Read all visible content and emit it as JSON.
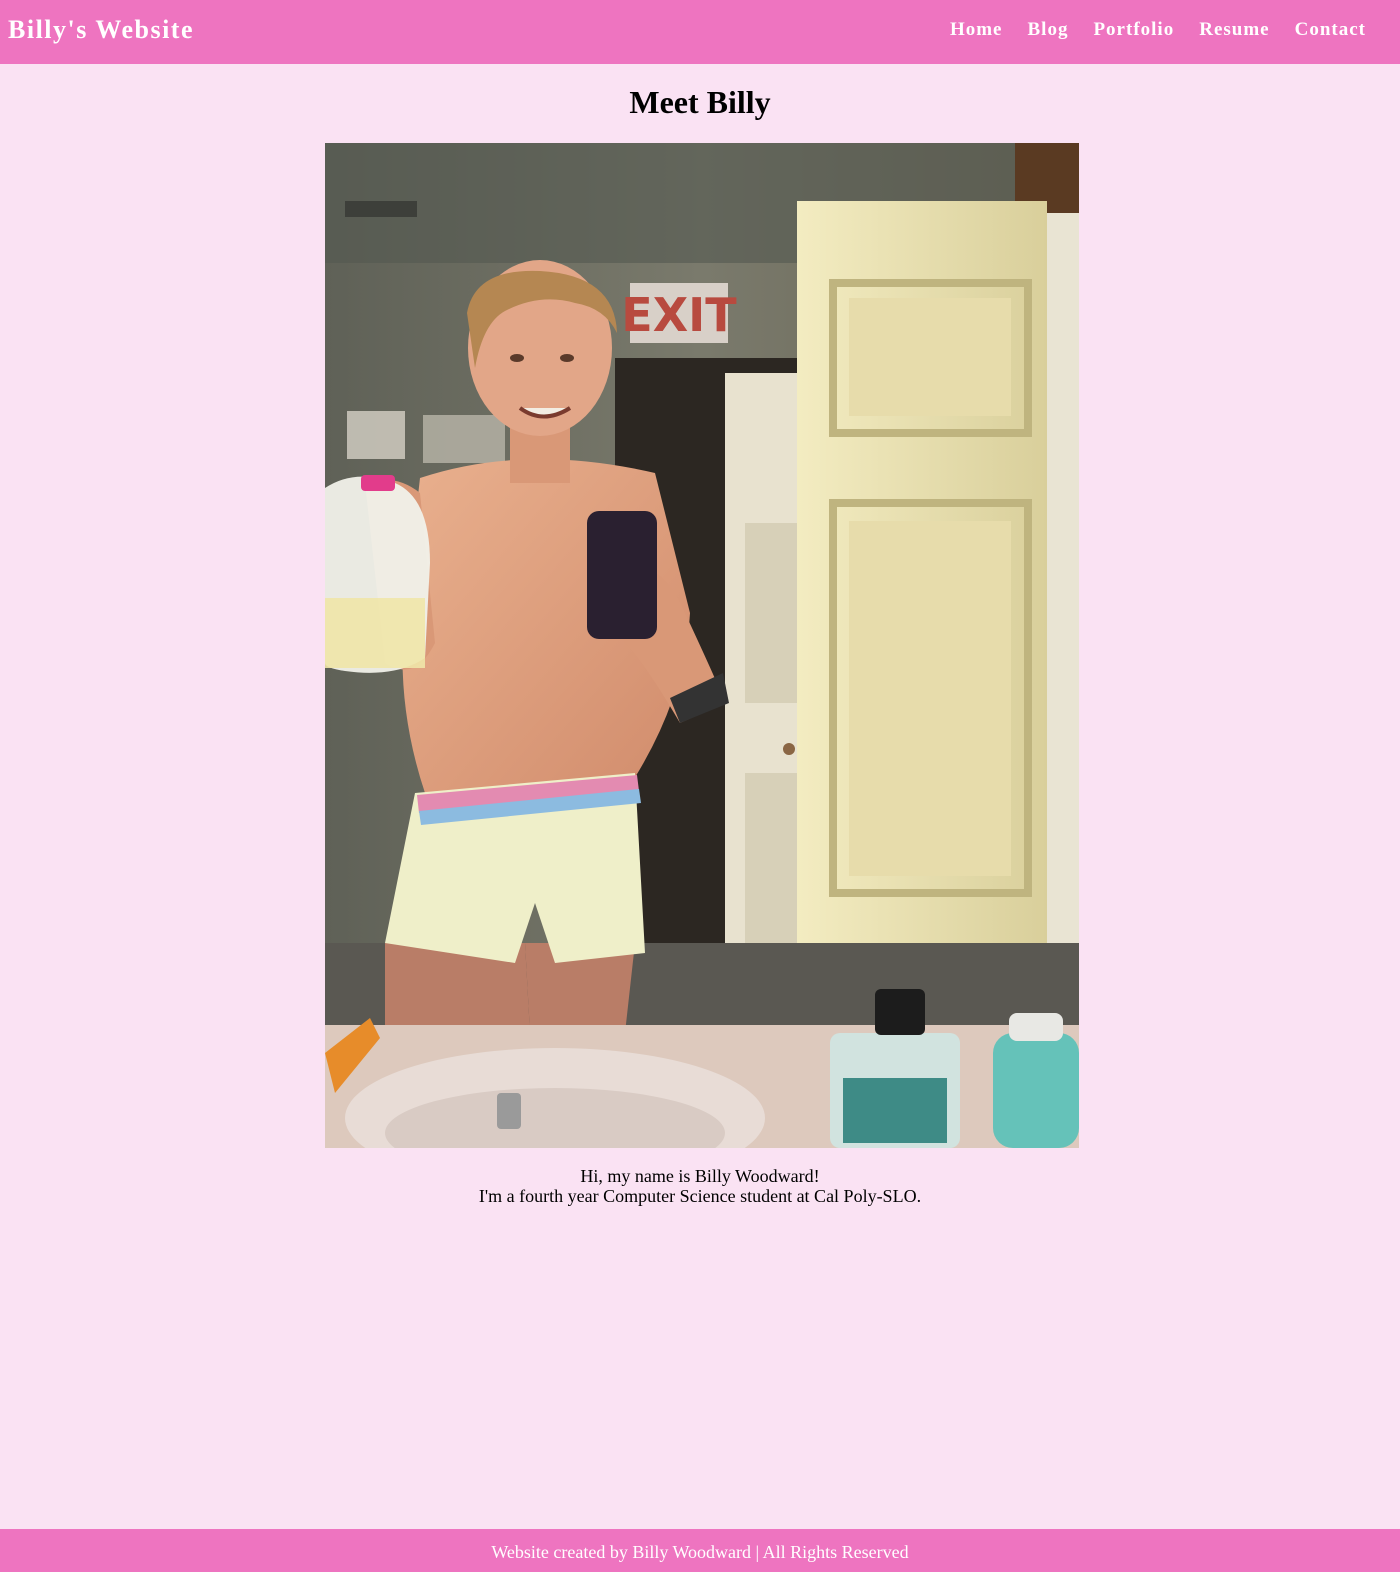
{
  "header": {
    "site_title": "Billy's Website",
    "nav": [
      {
        "label": "Home"
      },
      {
        "label": "Blog"
      },
      {
        "label": "Portfolio"
      },
      {
        "label": "Resume"
      },
      {
        "label": "Contact"
      }
    ]
  },
  "main": {
    "title": "Meet Billy",
    "photo": {
      "sign_text": "EXIT"
    },
    "intro_line1": "Hi, my name is Billy Woodward!",
    "intro_line2": "I'm a fourth year Computer Science student at Cal Poly-SLO."
  },
  "footer": {
    "text": "Website created by Billy Woodward | All Rights Reserved"
  },
  "colors": {
    "accent": "#ee74c0",
    "background": "#fae2f3",
    "nav_text": "#ffffff"
  }
}
